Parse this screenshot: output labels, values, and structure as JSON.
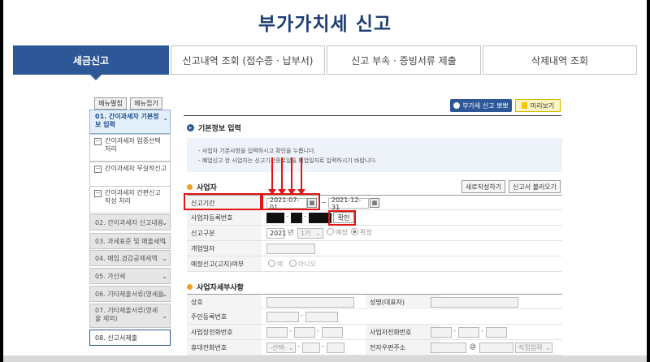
{
  "page_title": "부가가치세 신고",
  "tabs": [
    {
      "label": "세금신고"
    },
    {
      "label": "신고내역 조회 (접수증 · 납부서)"
    },
    {
      "label": "신고 부속 · 증빙서류 제출"
    },
    {
      "label": "삭제내역 조회"
    }
  ],
  "sidebar": {
    "menu_edit": "메뉴펼침",
    "menu_collapse": "메뉴접기",
    "active_item": "01. 간이과세자 기본정보 입력",
    "sub_items": [
      "간이과세자 업종선택 처리",
      "간이과세자 무실적신고",
      "간이과세자 간편신고 작성 처리"
    ],
    "items": [
      "02. 간이과세자 신고내용",
      "03. 과세표준 및 매출세액",
      "04. 매입.경감공제세액",
      "05. 가산세",
      "06. 기타제출서류(영세율",
      "07. 기타제출서류(영세율 제외)"
    ],
    "last_item": "08. 신고서제출"
  },
  "top_buttons": {
    "guide": "부가세 신고 뽀뽀",
    "preview": "미리보기"
  },
  "basic_info": {
    "title": "기본정보 입력",
    "notes": [
      "- 사업자 기본사항을 입력하시고 확인을 누릅니다.",
      "- 폐업신고 한 사업자는 신고기간종료일을 폐업일자로 입력하시기 바랍니다."
    ]
  },
  "business": {
    "title": "사업자",
    "new_write": "새로작성하기",
    "load": "신고서 불러오기",
    "period_label": "신고기간",
    "period_from": "2021-07-01",
    "period_to": "2021-12-31",
    "tilde": "~",
    "regno_label": "사업자등록번호",
    "confirm": "확인",
    "type_label": "신고구분",
    "year": "2021",
    "year_unit": "년",
    "term": "1기",
    "opt_scheduled": "예정",
    "opt_final": "확정",
    "open_date_label": "개업일자",
    "notice_label": "예정신고(고지)여부",
    "opt_yes": "예",
    "opt_no": "아니오"
  },
  "detail": {
    "title": "사업자세부사항",
    "trade_name": "상호",
    "rep_name": "성명(대표자)",
    "resident_no": "주민등록번호",
    "biz_phone": "사업장전화번호",
    "owner_phone": "사업자전화번호",
    "mobile": "휴대전화번호",
    "mobile_select": "-선택-",
    "email": "전자우편주소",
    "at": "@",
    "direct_input": "직접입력",
    "dash": "-"
  },
  "colors": {
    "primary": "#2d5797",
    "highlight": "#e31414",
    "title": "#1d3f75"
  }
}
